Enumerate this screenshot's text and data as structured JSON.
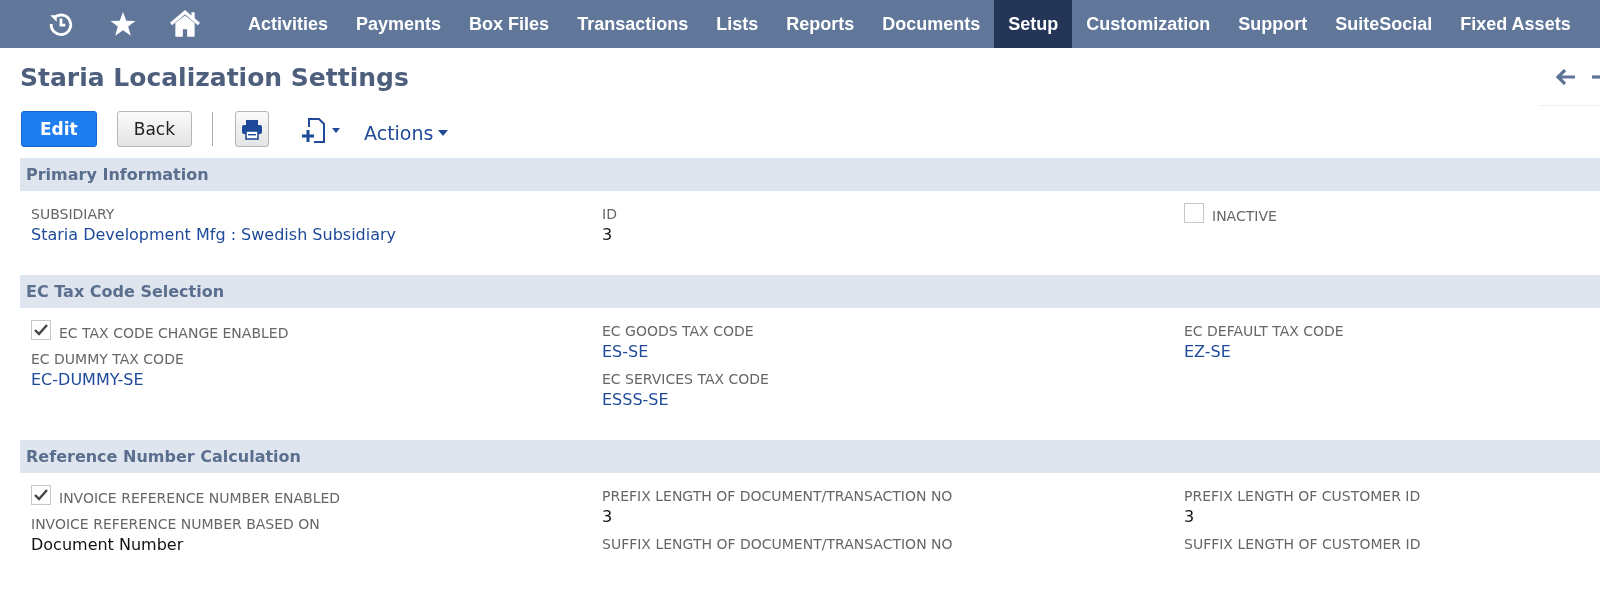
{
  "nav": {
    "items": [
      {
        "label": "Activities",
        "selected": false
      },
      {
        "label": "Payments",
        "selected": false
      },
      {
        "label": "Box Files",
        "selected": false
      },
      {
        "label": "Transactions",
        "selected": false
      },
      {
        "label": "Lists",
        "selected": false
      },
      {
        "label": "Reports",
        "selected": false
      },
      {
        "label": "Documents",
        "selected": false
      },
      {
        "label": "Setup",
        "selected": true
      },
      {
        "label": "Customization",
        "selected": false
      },
      {
        "label": "Support",
        "selected": false
      },
      {
        "label": "SuiteSocial",
        "selected": false
      },
      {
        "label": "Fixed Assets",
        "selected": false
      }
    ]
  },
  "page": {
    "title": "Staria Localization Settings"
  },
  "toolbar": {
    "primary_button": "Edit",
    "secondary_button": "Back",
    "actions": "Actions"
  },
  "sections": [
    {
      "title": "Primary Information",
      "columns": [
        [
          {
            "kind": "field",
            "label": "SUBSIDIARY",
            "value": "Staria Development Mfg : Swedish Subsidiary",
            "link": true
          }
        ],
        [
          {
            "kind": "field",
            "label": "ID",
            "value": "3",
            "link": false
          }
        ],
        [
          {
            "kind": "checkbox",
            "label": "INACTIVE",
            "checked": false
          }
        ]
      ]
    },
    {
      "title": "EC Tax Code Selection",
      "columns": [
        [
          {
            "kind": "checkbox",
            "label": "EC TAX CODE CHANGE ENABLED",
            "checked": true
          },
          {
            "kind": "field",
            "label": "EC DUMMY TAX CODE",
            "value": "EC-DUMMY-SE",
            "link": true
          }
        ],
        [
          {
            "kind": "field",
            "label": "EC GOODS TAX CODE",
            "value": "ES-SE",
            "link": true
          },
          {
            "kind": "field",
            "label": "EC SERVICES TAX CODE",
            "value": "ESSS-SE",
            "link": true
          }
        ],
        [
          {
            "kind": "field",
            "label": "EC DEFAULT TAX CODE",
            "value": "EZ-SE",
            "link": true
          }
        ]
      ]
    },
    {
      "title": "Reference Number Calculation",
      "columns": [
        [
          {
            "kind": "checkbox",
            "label": "INVOICE REFERENCE NUMBER ENABLED",
            "checked": true
          },
          {
            "kind": "field",
            "label": "INVOICE REFERENCE NUMBER BASED ON",
            "value": "Document Number",
            "link": false
          }
        ],
        [
          {
            "kind": "field",
            "label": "PREFIX LENGTH OF DOCUMENT/TRANSACTION NO",
            "value": "3",
            "link": false
          },
          {
            "kind": "field",
            "label": "SUFFIX LENGTH OF DOCUMENT/TRANSACTION NO"
          }
        ],
        [
          {
            "kind": "field",
            "label": "PREFIX LENGTH OF CUSTOMER ID",
            "value": "3",
            "link": false
          },
          {
            "kind": "field",
            "label": "SUFFIX LENGTH OF CUSTOMER ID"
          }
        ]
      ]
    }
  ]
}
